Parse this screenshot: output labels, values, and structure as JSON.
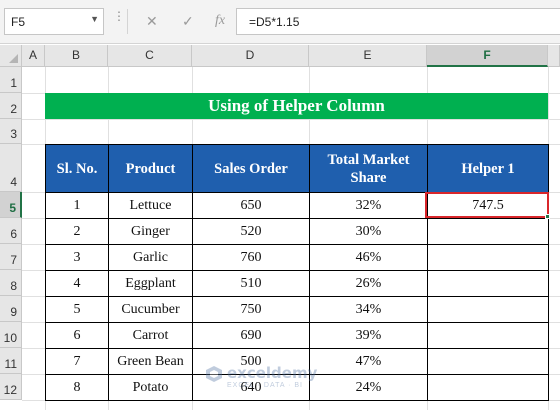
{
  "formula_bar": {
    "name_box": "F5",
    "cancel_icon": "✕",
    "enter_icon": "✓",
    "fx_label": "fx",
    "formula": "=D5*1.15"
  },
  "columns": [
    "A",
    "B",
    "C",
    "D",
    "E",
    "F"
  ],
  "rows": [
    "1",
    "2",
    "3",
    "4",
    "5",
    "6",
    "7",
    "8",
    "9",
    "10",
    "11",
    "12"
  ],
  "selected_cell": {
    "column": "F",
    "row": "5"
  },
  "sheet": {
    "title": "Using of Helper Column",
    "headers": [
      "Sl. No.",
      "Product",
      "Sales Order",
      "Total Market Share",
      "Helper 1"
    ],
    "data": [
      [
        "1",
        "Lettuce",
        "650",
        "32%",
        "747.5"
      ],
      [
        "2",
        "Ginger",
        "520",
        "30%",
        ""
      ],
      [
        "3",
        "Garlic",
        "760",
        "46%",
        ""
      ],
      [
        "4",
        "Eggplant",
        "510",
        "26%",
        ""
      ],
      [
        "5",
        "Cucumber",
        "750",
        "34%",
        ""
      ],
      [
        "6",
        "Carrot",
        "690",
        "39%",
        ""
      ],
      [
        "7",
        "Green Bean",
        "500",
        "47%",
        ""
      ],
      [
        "8",
        "Potato",
        "640",
        "24%",
        ""
      ]
    ]
  },
  "watermark": {
    "name": "exceldemy",
    "tagline": "EXCEL · DATA · BI"
  },
  "colors": {
    "banner": "#00b050",
    "table_header": "#1f5fae",
    "selection_border": "#d9262b",
    "excel_green": "#217346"
  }
}
